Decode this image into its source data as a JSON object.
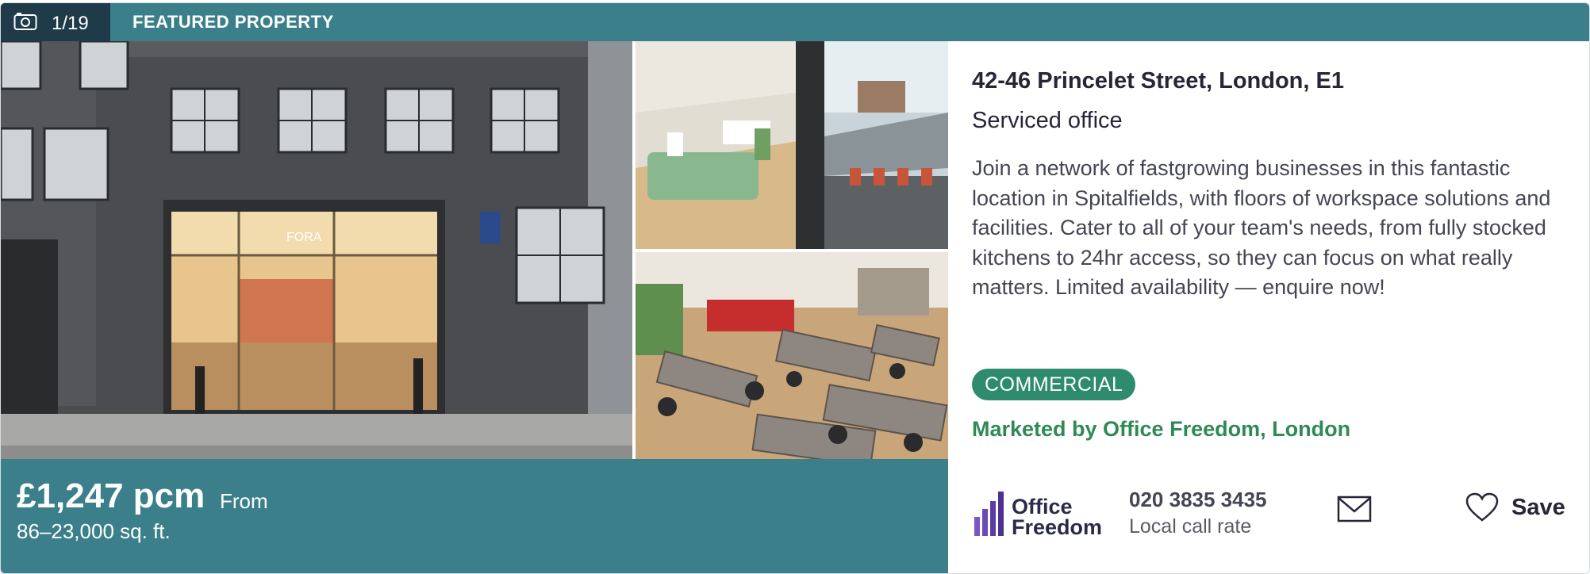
{
  "banner": {
    "photo_counter": "1/19",
    "label": "FEATURED PROPERTY"
  },
  "listing": {
    "price": "£1,247 pcm",
    "price_suffix": "From",
    "size": "86–23,000 sq. ft.",
    "address": "42-46 Princelet Street, London, E1",
    "property_type": "Serviced office",
    "description": "Join a network of fastgrowing businesses in this fantastic location in Spitalfields, with floors of workspace solutions and facilities. Cater to all of your team's needs, from fully stocked kitchens to 24hr access, so they can focus on what really matters. Limited availability — enquire now!",
    "category_badge": "COMMERCIAL",
    "marketed_by": "Marketed by Office Freedom, London"
  },
  "agent": {
    "logo_text_line1": "Office",
    "logo_text_line2": "Freedom",
    "phone": "020 3835 3435",
    "call_rate": "Local call rate"
  },
  "actions": {
    "save_label": "Save",
    "icons": [
      "camera-icon",
      "mail-icon",
      "heart-icon"
    ]
  },
  "colors": {
    "teal": "#3b7f8a",
    "counter_bg": "#1f3a48",
    "badge_green": "#2e8b6e",
    "marketed_green": "#2f8a55",
    "logo_purple": "#6b4bb3"
  }
}
